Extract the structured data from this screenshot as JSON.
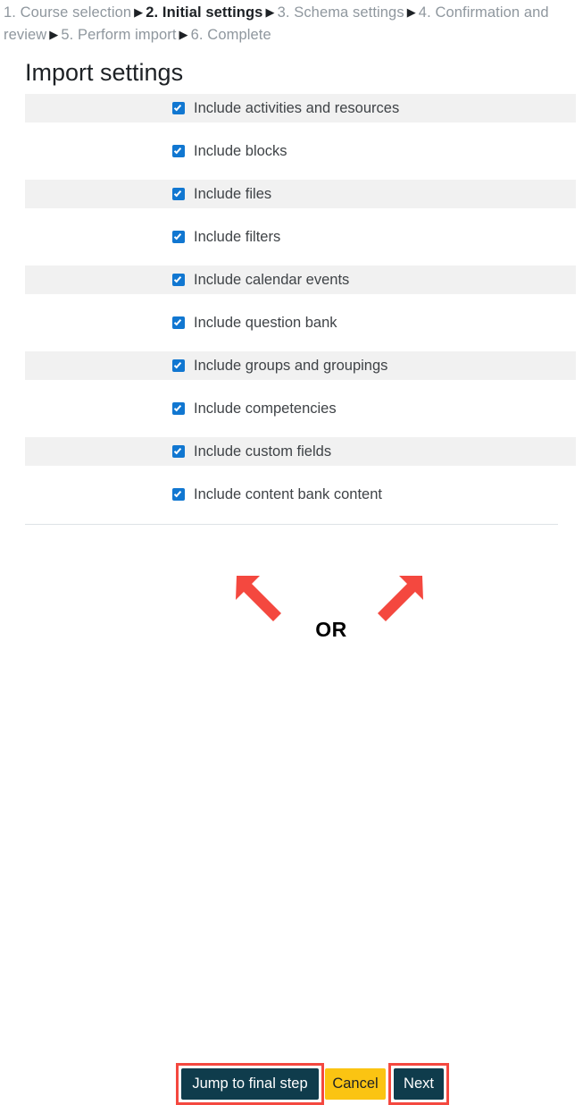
{
  "breadcrumb": {
    "separator": "▶",
    "steps": [
      {
        "label": "1. Course selection",
        "current": false
      },
      {
        "label": "2. Initial settings",
        "current": true
      },
      {
        "label": "3. Schema settings",
        "current": false
      },
      {
        "label": "4. Confirmation and review",
        "current": false
      },
      {
        "label": "5. Perform import",
        "current": false
      },
      {
        "label": "6. Complete",
        "current": false
      }
    ]
  },
  "page": {
    "title": "Import settings"
  },
  "settings": {
    "items": [
      {
        "label": "Include activities and resources",
        "checked": true
      },
      {
        "label": "Include blocks",
        "checked": true
      },
      {
        "label": "Include files",
        "checked": true
      },
      {
        "label": "Include filters",
        "checked": true
      },
      {
        "label": "Include calendar events",
        "checked": true
      },
      {
        "label": "Include question bank",
        "checked": true
      },
      {
        "label": "Include groups and groupings",
        "checked": true
      },
      {
        "label": "Include competencies",
        "checked": true
      },
      {
        "label": "Include custom fields",
        "checked": true
      },
      {
        "label": "Include content bank content",
        "checked": true
      }
    ]
  },
  "buttons": {
    "jump_to_final_step": "Jump to final step",
    "cancel": "Cancel",
    "next": "Next"
  },
  "annotation": {
    "or_label": "OR",
    "arrow_color": "#f4483f",
    "highlight_color": "#f4483f"
  },
  "colors": {
    "checkbox_blue": "#1177d1",
    "button_dark": "#0f3c4c",
    "button_yellow": "#fbc412",
    "stripe_gray": "#f1f1f1",
    "breadcrumb_muted": "#8f979e",
    "text_dark": "#1d2125"
  }
}
